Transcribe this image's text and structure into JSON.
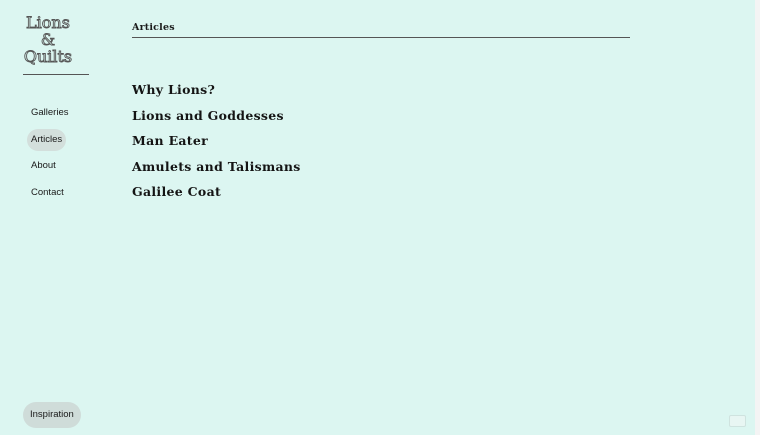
{
  "logo": {
    "lines": [
      "Lions",
      "&",
      "Quilts"
    ]
  },
  "sidebar": {
    "items": [
      {
        "label": "Galleries",
        "active": false
      },
      {
        "label": "Articles",
        "active": true
      },
      {
        "label": "About",
        "active": false
      },
      {
        "label": "Contact",
        "active": false
      }
    ],
    "footer_button": "Inspiration"
  },
  "main": {
    "section_title": "Articles",
    "articles": [
      "Why Lions?",
      "Lions and Goddesses",
      "Man Eater",
      "Amulets and Talismans",
      "Galilee Coat"
    ]
  },
  "colors": {
    "background": "#dcf6f1",
    "active_pill": "#d3dfdc",
    "rule": "#555555"
  }
}
